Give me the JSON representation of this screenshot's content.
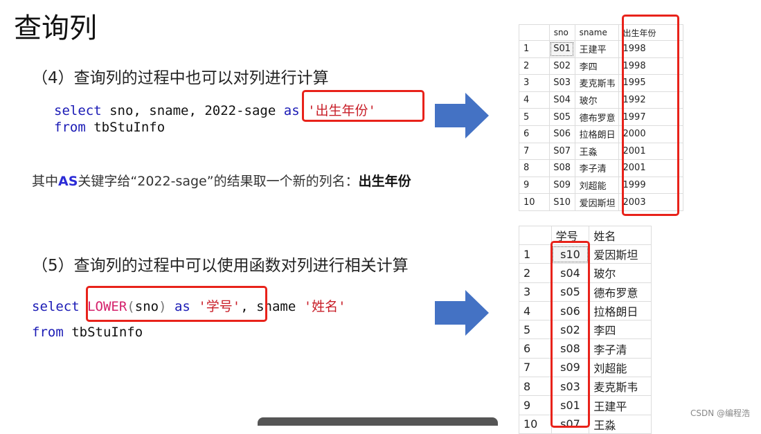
{
  "title": "查询列",
  "section4": {
    "heading": "（4）查询列的过程中也可以对列进行计算",
    "code_line1": {
      "kw": "select",
      "text": " sno, sname, 2022-sage ",
      "as": "as",
      "str": "'出生年份'"
    },
    "code_line2": {
      "kw": "from",
      "text": " tbStuInfo"
    },
    "note": {
      "prefix": "其中",
      "as": "AS",
      "mid": "关键字给“2022-sage”的结果取一个新的列名：",
      "bold": "出生年份"
    }
  },
  "section5": {
    "heading": "（5）查询列的过程中可以使用函数对列进行相关计算",
    "code_line1": {
      "kw": "select",
      "fn": "LOWER",
      "lp": "(",
      "arg": "sno",
      "rp": ")",
      "as": "as",
      "str1": "'学号'",
      "rest": ", sname ",
      "str2": "'姓名'"
    },
    "code_line2": {
      "kw": "from",
      "text": " tbStuInfo"
    }
  },
  "table1": {
    "headers": [
      "",
      "sno",
      "sname",
      "出生年份"
    ],
    "rows": [
      [
        "1",
        "S01",
        "王建平",
        "1998"
      ],
      [
        "2",
        "S02",
        "李四",
        "1998"
      ],
      [
        "3",
        "S03",
        "麦克斯韦",
        "1995"
      ],
      [
        "4",
        "S04",
        "玻尔",
        "1992"
      ],
      [
        "5",
        "S05",
        "德布罗意",
        "1997"
      ],
      [
        "6",
        "S06",
        "拉格朗日",
        "2000"
      ],
      [
        "7",
        "S07",
        "王淼",
        "2001"
      ],
      [
        "8",
        "S08",
        "李子清",
        "2001"
      ],
      [
        "9",
        "S09",
        "刘超能",
        "1999"
      ],
      [
        "10",
        "S10",
        "爱因斯坦",
        "2003"
      ]
    ]
  },
  "table2": {
    "headers": [
      "",
      "学号",
      "姓名"
    ],
    "rows": [
      [
        "1",
        "s10",
        "爱因斯坦"
      ],
      [
        "2",
        "s04",
        "玻尔"
      ],
      [
        "3",
        "s05",
        "德布罗意"
      ],
      [
        "4",
        "s06",
        "拉格朗日"
      ],
      [
        "5",
        "s02",
        "李四"
      ],
      [
        "6",
        "s08",
        "李子清"
      ],
      [
        "7",
        "s09",
        "刘超能"
      ],
      [
        "8",
        "s03",
        "麦克斯韦"
      ],
      [
        "9",
        "s01",
        "王建平"
      ],
      [
        "10",
        "s07",
        "王淼"
      ]
    ]
  },
  "watermark": "CSDN @编程浩",
  "colors": {
    "highlight": "#e8221a",
    "arrow": "#4472c4",
    "keyword": "#1a1ab5",
    "string": "#c81e28"
  }
}
